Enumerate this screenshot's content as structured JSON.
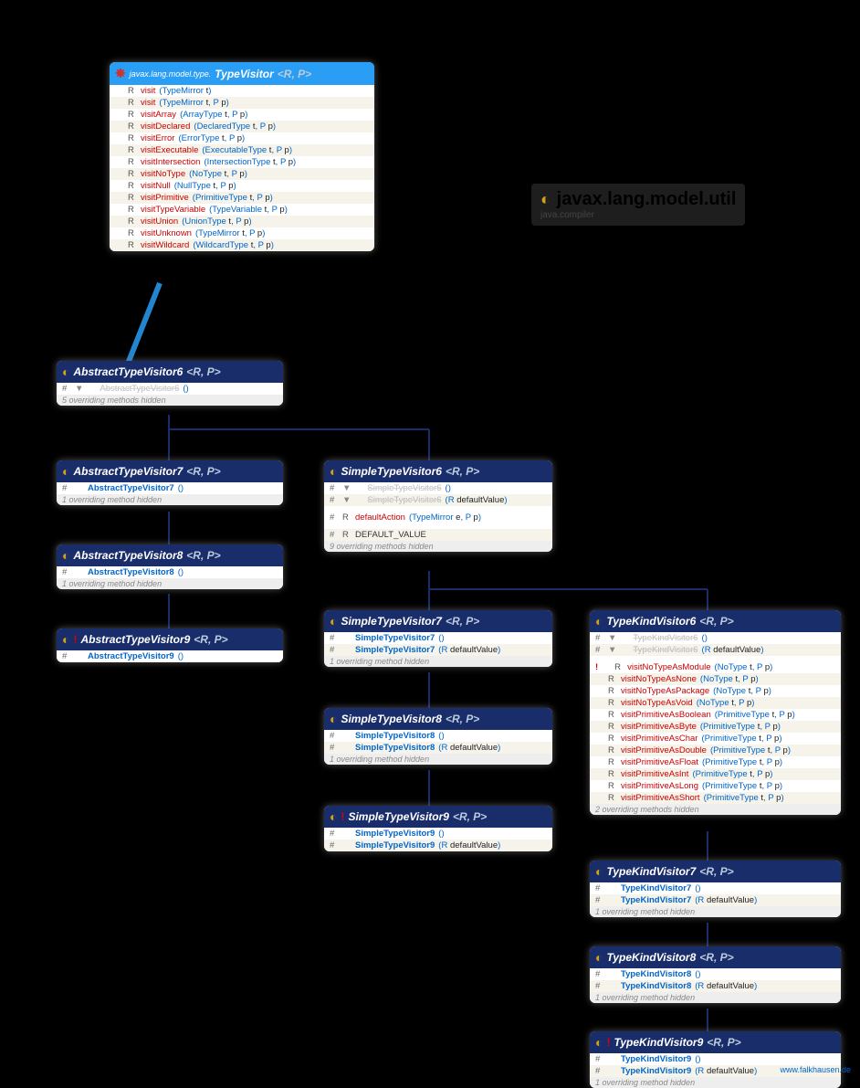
{
  "page_title": {
    "package": "javax.lang.model.util",
    "module": "java.compiler"
  },
  "credit": "www.falkhausen.de",
  "typevisitor": {
    "pkgpath": "javax.lang.model.type.",
    "name": "TypeVisitor",
    "generics": "<R, P>",
    "rows": [
      {
        "ret": "R",
        "name": "visit",
        "args": "(TypeMirror t)"
      },
      {
        "ret": "R",
        "name": "visit",
        "args": "(TypeMirror t, P p)"
      },
      {
        "ret": "R",
        "name": "visitArray",
        "args": "(ArrayType t, P p)"
      },
      {
        "ret": "R",
        "name": "visitDeclared",
        "args": "(DeclaredType t, P p)"
      },
      {
        "ret": "R",
        "name": "visitError",
        "args": "(ErrorType t, P p)"
      },
      {
        "ret": "R",
        "name": "visitExecutable",
        "args": "(ExecutableType t, P p)"
      },
      {
        "ret": "R",
        "name": "visitIntersection",
        "args": "(IntersectionType t, P p)"
      },
      {
        "ret": "R",
        "name": "visitNoType",
        "args": "(NoType t, P p)"
      },
      {
        "ret": "R",
        "name": "visitNull",
        "args": "(NullType t, P p)"
      },
      {
        "ret": "R",
        "name": "visitPrimitive",
        "args": "(PrimitiveType t, P p)"
      },
      {
        "ret": "R",
        "name": "visitTypeVariable",
        "args": "(TypeVariable t, P p)"
      },
      {
        "ret": "R",
        "name": "visitUnion",
        "args": "(UnionType t, P p)"
      },
      {
        "ret": "R",
        "name": "visitUnknown",
        "args": "(TypeMirror t, P p)"
      },
      {
        "ret": "R",
        "name": "visitWildcard",
        "args": "(WildcardType t, P p)"
      }
    ]
  },
  "atv6": {
    "name": "AbstractTypeVisitor6",
    "generics": "<R, P>",
    "rows": [
      {
        "vis": "#",
        "name": "AbstractTypeVisitor6",
        "args": "()",
        "dim": true
      }
    ],
    "note": "5 overriding methods hidden"
  },
  "atv7": {
    "name": "AbstractTypeVisitor7",
    "generics": "<R, P>",
    "rows": [
      {
        "vis": "#",
        "name": "AbstractTypeVisitor7",
        "args": "()",
        "link": true
      }
    ],
    "note": "1 overriding method hidden"
  },
  "atv8": {
    "name": "AbstractTypeVisitor8",
    "generics": "<R, P>",
    "rows": [
      {
        "vis": "#",
        "name": "AbstractTypeVisitor8",
        "args": "()",
        "link": true
      }
    ],
    "note": "1 overriding method hidden"
  },
  "atv9": {
    "name": "AbstractTypeVisitor9",
    "generics": "<R, P>",
    "excl": true,
    "rows": [
      {
        "vis": "#",
        "name": "AbstractTypeVisitor9",
        "args": "()",
        "link": true
      }
    ]
  },
  "stv6": {
    "name": "SimpleTypeVisitor6",
    "generics": "<R, P>",
    "rows": [
      {
        "vis": "#",
        "name": "SimpleTypeVisitor6",
        "args": "()",
        "dim": true
      },
      {
        "vis": "#",
        "name": "SimpleTypeVisitor6",
        "args": "(R defaultValue)",
        "dim": true
      }
    ],
    "extra": [
      {
        "vis": "#",
        "ret": "R",
        "name": "defaultAction",
        "args": "(TypeMirror e, P p)"
      }
    ],
    "field": {
      "vis": "#",
      "ret": "R",
      "name": "DEFAULT_VALUE"
    },
    "note": "9 overriding methods hidden"
  },
  "stv7": {
    "name": "SimpleTypeVisitor7",
    "generics": "<R, P>",
    "rows": [
      {
        "vis": "#",
        "name": "SimpleTypeVisitor7",
        "args": "()",
        "link": true
      },
      {
        "vis": "#",
        "name": "SimpleTypeVisitor7",
        "args": "(R defaultValue)",
        "link": true
      }
    ],
    "note": "1 overriding method hidden"
  },
  "stv8": {
    "name": "SimpleTypeVisitor8",
    "generics": "<R, P>",
    "rows": [
      {
        "vis": "#",
        "name": "SimpleTypeVisitor8",
        "args": "()",
        "link": true
      },
      {
        "vis": "#",
        "name": "SimpleTypeVisitor8",
        "args": "(R defaultValue)",
        "link": true
      }
    ],
    "note": "1 overriding method hidden"
  },
  "stv9": {
    "name": "SimpleTypeVisitor9",
    "generics": "<R, P>",
    "excl": true,
    "rows": [
      {
        "vis": "#",
        "name": "SimpleTypeVisitor9",
        "args": "()",
        "link": true
      },
      {
        "vis": "#",
        "name": "SimpleTypeVisitor9",
        "args": "(R defaultValue)",
        "link": true
      }
    ]
  },
  "tkv6": {
    "name": "TypeKindVisitor6",
    "generics": "<R, P>",
    "rows": [
      {
        "vis": "#",
        "name": "TypeKindVisitor6",
        "args": "()",
        "dim": true
      },
      {
        "vis": "#",
        "name": "TypeKindVisitor6",
        "args": "(R defaultValue)",
        "dim": true
      }
    ],
    "methods": [
      {
        "ret": "R",
        "name": "visitNoTypeAsModule",
        "args": "(NoType t, P p)",
        "excl": true
      },
      {
        "ret": "R",
        "name": "visitNoTypeAsNone",
        "args": "(NoType t, P p)"
      },
      {
        "ret": "R",
        "name": "visitNoTypeAsPackage",
        "args": "(NoType t, P p)"
      },
      {
        "ret": "R",
        "name": "visitNoTypeAsVoid",
        "args": "(NoType t, P p)"
      },
      {
        "ret": "R",
        "name": "visitPrimitiveAsBoolean",
        "args": "(PrimitiveType t, P p)"
      },
      {
        "ret": "R",
        "name": "visitPrimitiveAsByte",
        "args": "(PrimitiveType t, P p)"
      },
      {
        "ret": "R",
        "name": "visitPrimitiveAsChar",
        "args": "(PrimitiveType t, P p)"
      },
      {
        "ret": "R",
        "name": "visitPrimitiveAsDouble",
        "args": "(PrimitiveType t, P p)"
      },
      {
        "ret": "R",
        "name": "visitPrimitiveAsFloat",
        "args": "(PrimitiveType t, P p)"
      },
      {
        "ret": "R",
        "name": "visitPrimitiveAsInt",
        "args": "(PrimitiveType t, P p)"
      },
      {
        "ret": "R",
        "name": "visitPrimitiveAsLong",
        "args": "(PrimitiveType t, P p)"
      },
      {
        "ret": "R",
        "name": "visitPrimitiveAsShort",
        "args": "(PrimitiveType t, P p)"
      }
    ],
    "note": "2 overriding methods hidden"
  },
  "tkv7": {
    "name": "TypeKindVisitor7",
    "generics": "<R, P>",
    "rows": [
      {
        "vis": "#",
        "name": "TypeKindVisitor7",
        "args": "()",
        "link": true
      },
      {
        "vis": "#",
        "name": "TypeKindVisitor7",
        "args": "(R defaultValue)",
        "link": true
      }
    ],
    "note": "1 overriding method hidden"
  },
  "tkv8": {
    "name": "TypeKindVisitor8",
    "generics": "<R, P>",
    "rows": [
      {
        "vis": "#",
        "name": "TypeKindVisitor8",
        "args": "()",
        "link": true
      },
      {
        "vis": "#",
        "name": "TypeKindVisitor8",
        "args": "(R defaultValue)",
        "link": true
      }
    ],
    "note": "1 overriding method hidden"
  },
  "tkv9": {
    "name": "TypeKindVisitor9",
    "generics": "<R, P>",
    "excl": true,
    "rows": [
      {
        "vis": "#",
        "name": "TypeKindVisitor9",
        "args": "()",
        "link": true
      },
      {
        "vis": "#",
        "name": "TypeKindVisitor9",
        "args": "(R defaultValue)",
        "link": true
      }
    ],
    "note": "1 overriding method hidden"
  }
}
